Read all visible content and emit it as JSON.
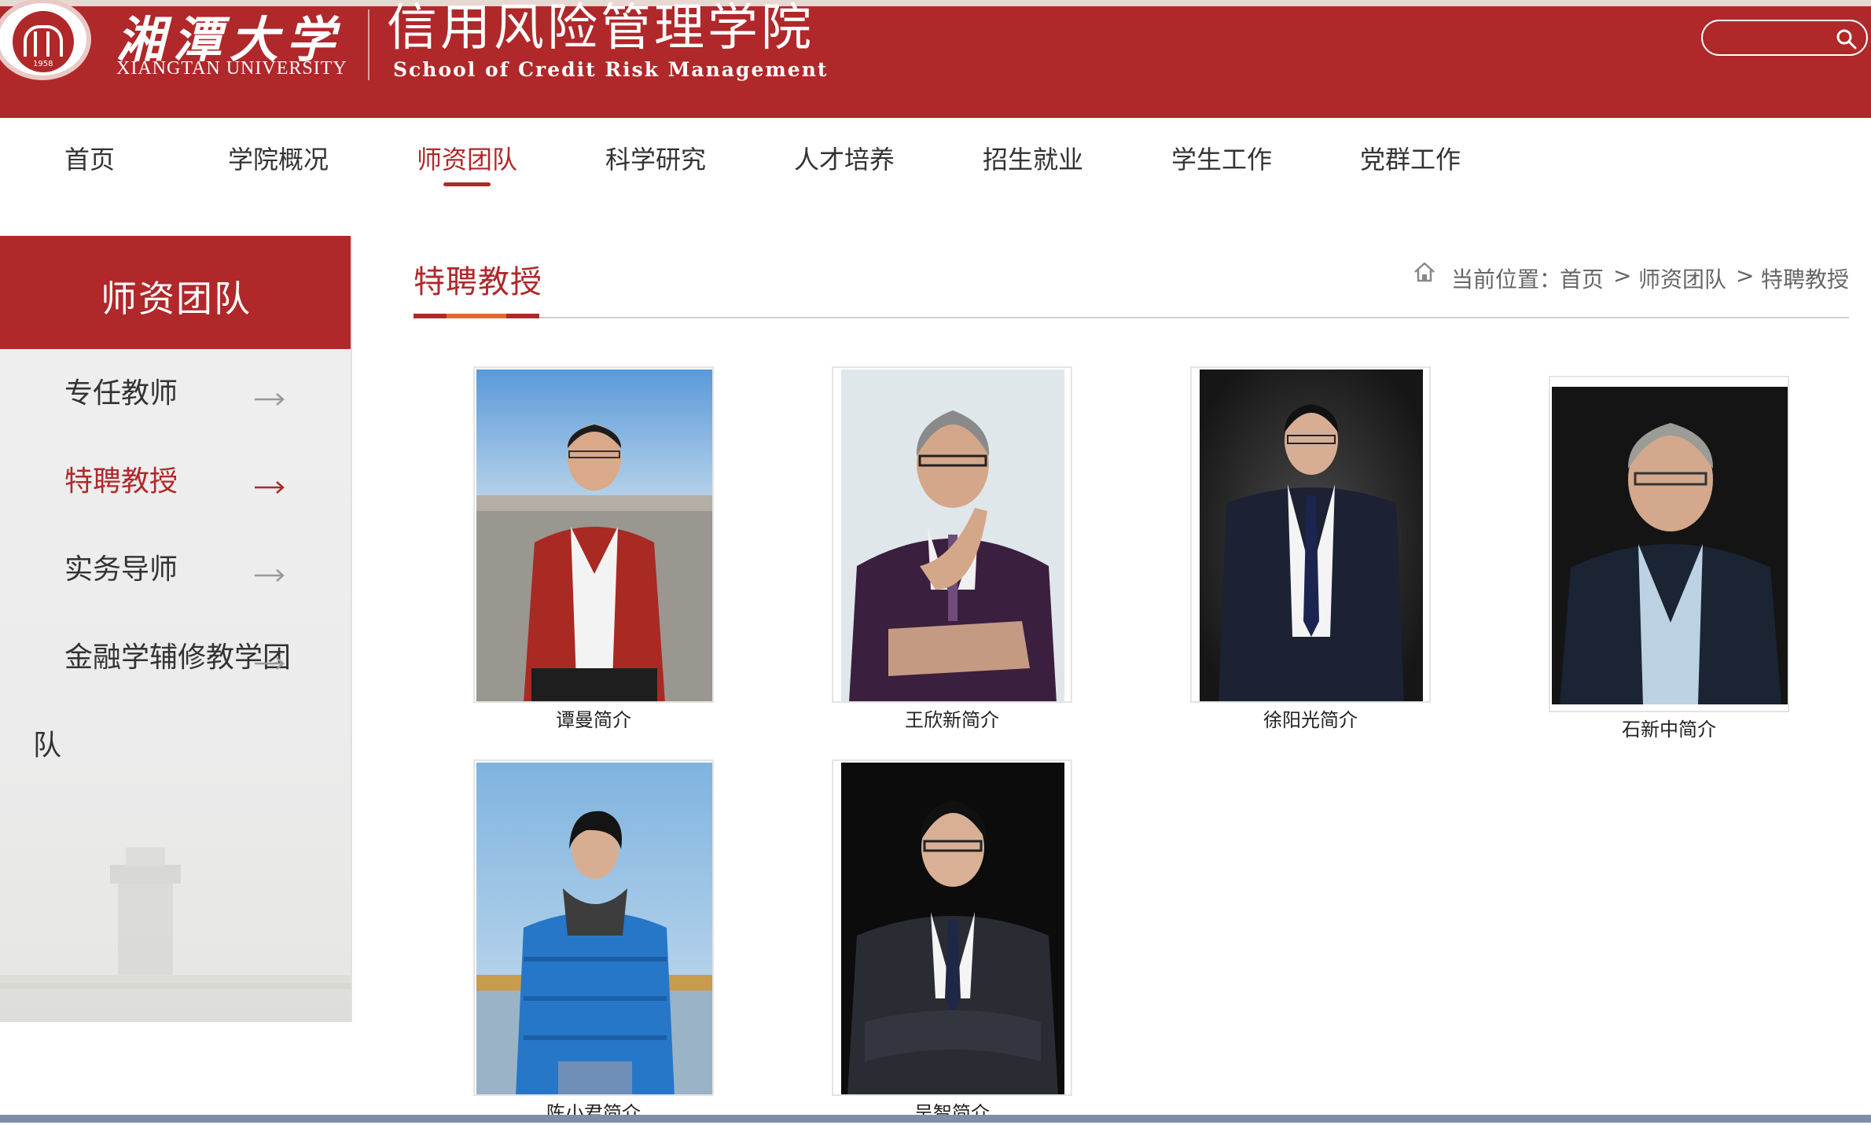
{
  "header": {
    "school_cn": "湘潭大学",
    "school_en": "XIANGTAN UNIVERSITY",
    "college_cn": "信用风险管理学院",
    "college_en": "School of Credit Risk Management",
    "seal_year": "1958",
    "search_placeholder": "",
    "brand_color": "#b0282a"
  },
  "nav": {
    "items": [
      {
        "label": "首页"
      },
      {
        "label": "学院概况"
      },
      {
        "label": "师资团队"
      },
      {
        "label": "科学研究"
      },
      {
        "label": "人才培养"
      },
      {
        "label": "招生就业"
      },
      {
        "label": "学生工作"
      },
      {
        "label": "党群工作"
      }
    ],
    "active_index": 2
  },
  "sidebar": {
    "title": "师资团队",
    "items": [
      {
        "label": "专任教师"
      },
      {
        "label": "特聘教授"
      },
      {
        "label": "实务导师"
      },
      {
        "label": "金融学辅修教学团",
        "label_wrap": "队"
      }
    ],
    "active_index": 1
  },
  "main": {
    "section_title": "特聘教授",
    "breadcrumb": {
      "prefix": "当前位置：",
      "home": "首页",
      "sep": ">",
      "level1": "师资团队",
      "level2": "特聘教授"
    },
    "professors": [
      {
        "caption": "谭曼简介",
        "photo": "red-blazer-desert"
      },
      {
        "caption": "王欣新简介",
        "photo": "purple-suit-studio"
      },
      {
        "caption": "徐阳光简介",
        "photo": "navy-suit-dark"
      },
      {
        "caption": "石新中简介",
        "photo": "navy-jacket-dark"
      },
      {
        "caption": "陈小君简介",
        "photo": "blue-down-jacket-lake"
      },
      {
        "caption": "吴智简介",
        "photo": "dark-suit-black"
      }
    ]
  }
}
